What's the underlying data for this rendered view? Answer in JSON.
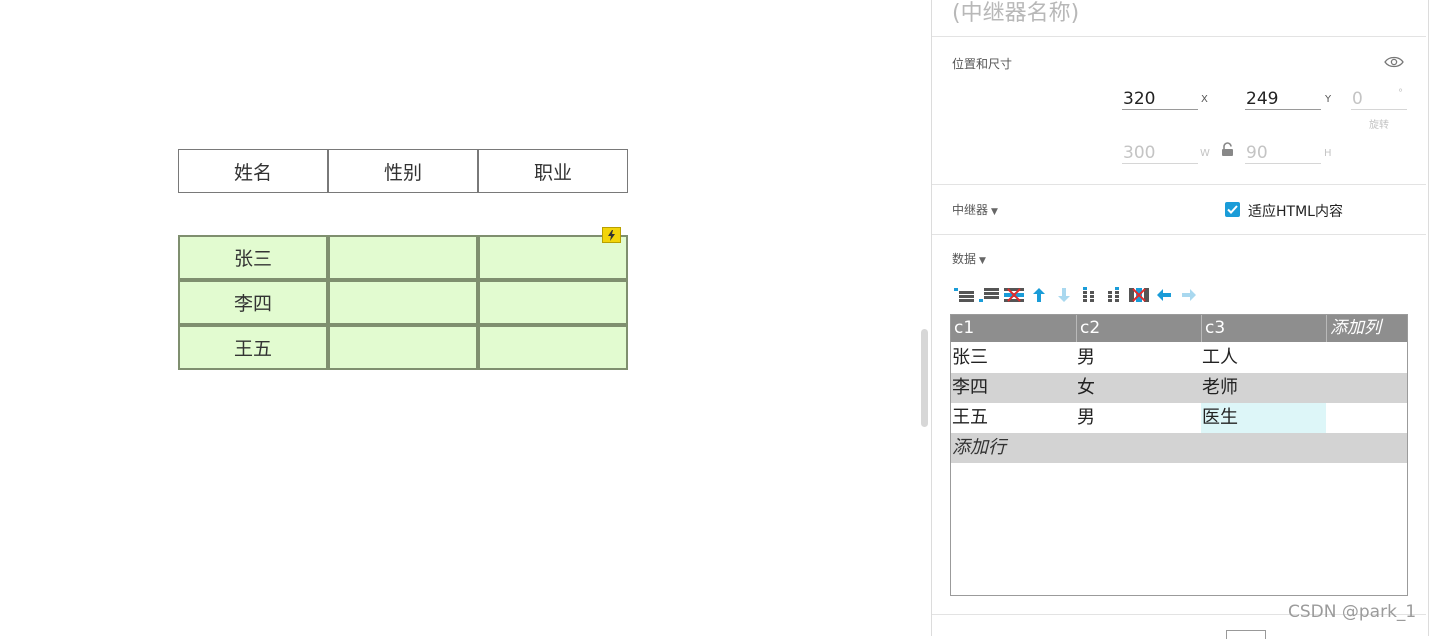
{
  "canvas": {
    "header_cells": [
      "姓名",
      "性别",
      "职业"
    ],
    "repeater_rows": [
      [
        "张三",
        "",
        ""
      ],
      [
        "李四",
        "",
        ""
      ],
      [
        "王五",
        "",
        ""
      ]
    ]
  },
  "panel": {
    "repeater_name_placeholder": "(中继器名称)",
    "position_size": {
      "label": "位置和尺寸",
      "x": "320",
      "x_unit": "X",
      "y": "249",
      "y_unit": "Y",
      "rotation": "0",
      "rotation_unit": "°",
      "rotation_label": "旋转",
      "w": "300",
      "w_unit": "W",
      "h": "90",
      "h_unit": "H"
    },
    "repeater_section": {
      "label": "中继器",
      "fit_html_label": "适应HTML内容",
      "fit_html_checked": true
    },
    "data_section": {
      "label": "数据",
      "toolbar_icons": [
        "insert-row-above-icon",
        "insert-row-below-icon",
        "delete-row-icon",
        "move-up-icon",
        "move-down-icon",
        "insert-column-left-icon",
        "insert-column-right-icon",
        "delete-column-icon",
        "move-left-icon",
        "move-right-icon"
      ],
      "columns": [
        "c1",
        "c2",
        "c3"
      ],
      "add_column": "添加列",
      "rows": [
        [
          "张三",
          "男",
          "工人"
        ],
        [
          "李四",
          "女",
          "老师"
        ],
        [
          "王五",
          "男",
          "医生"
        ]
      ],
      "add_row": "添加行"
    }
  },
  "watermark": "CSDN @park_1",
  "colors": {
    "accent": "#1a9cd8",
    "repeater_fill": "#e2fbd0",
    "repeater_border": "#3fc4a8",
    "grid_header": "#8e8e8e",
    "selected_cell": "#ddf6f8"
  }
}
